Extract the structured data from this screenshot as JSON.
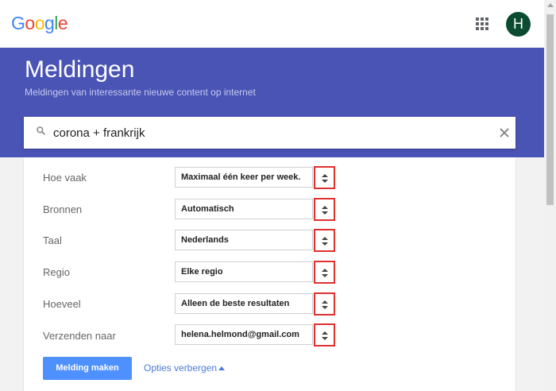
{
  "brand": {
    "logo_letters": [
      {
        "char": "G",
        "color": "#4285F4"
      },
      {
        "char": "o",
        "color": "#EA4335"
      },
      {
        "char": "o",
        "color": "#FBBC05"
      },
      {
        "char": "g",
        "color": "#4285F4"
      },
      {
        "char": "l",
        "color": "#34A853"
      },
      {
        "char": "e",
        "color": "#EA4335"
      }
    ]
  },
  "header": {
    "apps_icon": "apps-grid-icon",
    "avatar_initial": "H",
    "avatar_color": "#0b4b32"
  },
  "hero": {
    "title": "Meldingen",
    "subtitle": "Meldingen van interessante nieuwe content op internet",
    "background": "#4a54b5"
  },
  "search": {
    "value": "corona + frankrijk",
    "icon": "search-icon",
    "clear_icon": "close-icon"
  },
  "options": [
    {
      "label": "Hoe vaak",
      "value": "Maximaal één keer per week."
    },
    {
      "label": "Bronnen",
      "value": "Automatisch"
    },
    {
      "label": "Taal",
      "value": "Nederlands"
    },
    {
      "label": "Regio",
      "value": "Elke regio"
    },
    {
      "label": "Hoeveel",
      "value": "Alleen de beste resultaten"
    },
    {
      "label": "Verzenden naar",
      "value": "helena.helmond@gmail.com"
    }
  ],
  "actions": {
    "create_label": "Melding maken",
    "options_link": "Opties verbergen"
  },
  "colors": {
    "primary_button": "#4d90fe",
    "link": "#4a7bd6",
    "highlight_border": "#e03030"
  }
}
